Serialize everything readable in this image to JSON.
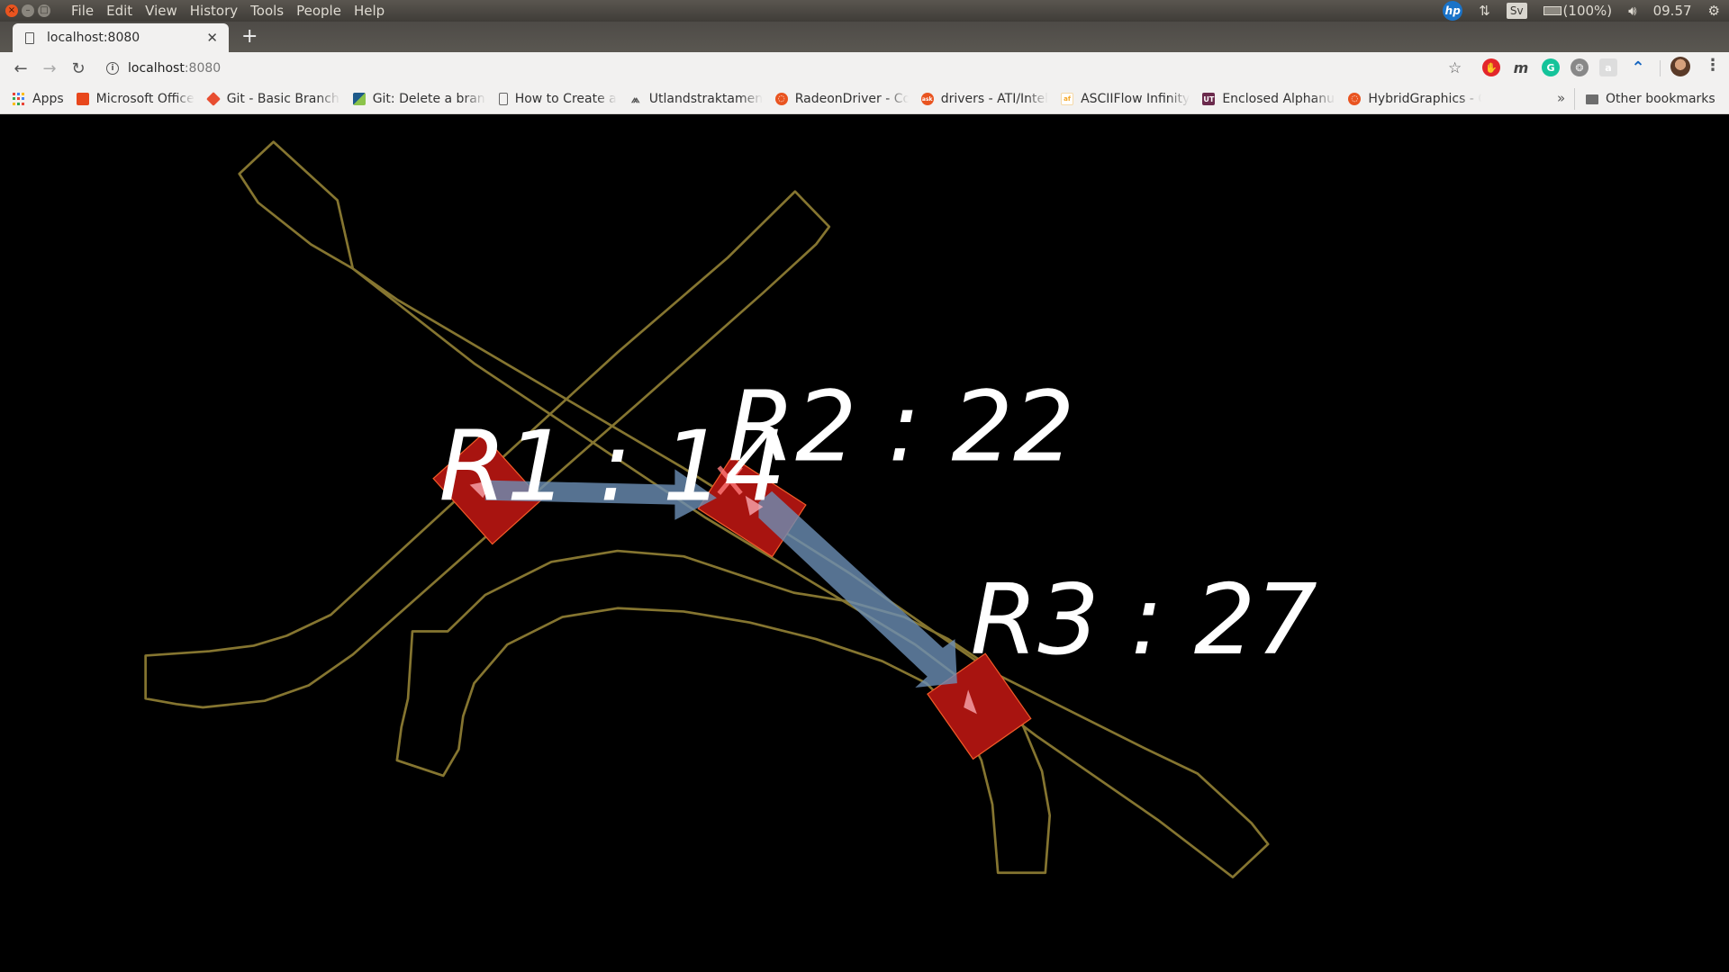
{
  "os": {
    "menu": [
      "File",
      "Edit",
      "View",
      "History",
      "Tools",
      "People",
      "Help"
    ],
    "tray": {
      "keyboard_layout": "Sv",
      "battery": "(100%)",
      "time": "09.57"
    }
  },
  "browser": {
    "tab": {
      "title": "localhost:8080"
    },
    "address": {
      "host": "localhost",
      "port": ":8080"
    },
    "bookmarks": [
      {
        "label": "Apps",
        "icon": "apps-grid-icon"
      },
      {
        "label": "Microsoft Office",
        "icon": "office-icon",
        "color": "#e8471c"
      },
      {
        "label": "Git - Basic Branching",
        "icon": "git-icon",
        "color": "#e84e31"
      },
      {
        "label": "Git: Delete a branch",
        "icon": "git-tower-icon",
        "color": "#1e5a8a"
      },
      {
        "label": "How to Create a",
        "icon": "page-icon"
      },
      {
        "label": "Utlandstraktamente",
        "icon": "skatteverket-icon"
      },
      {
        "label": "RadeonDriver - Community",
        "icon": "ubuntu-icon",
        "color": "#e95420"
      },
      {
        "label": "drivers - ATI/Intel",
        "icon": "askubuntu-icon",
        "color": "#e95420"
      },
      {
        "label": "ASCIIFlow Infinity",
        "icon": "asciiflow-icon",
        "color": "#f5a623"
      },
      {
        "label": "Enclosed Alphanumerics",
        "icon": "unicode-table-icon",
        "color": "#6b2a4c"
      },
      {
        "label": "HybridGraphics - Community",
        "icon": "ubuntu-icon",
        "color": "#e95420"
      }
    ],
    "overflow": "»",
    "other_bookmarks": "Other bookmarks",
    "extensions": [
      "adblock-icon",
      "m-extension-icon",
      "grammarly-icon",
      "film-reel-icon",
      "chat-extension-icon",
      "vpn-extension-icon"
    ]
  },
  "scene": {
    "colors": {
      "background": "#000000",
      "road_outline": "#857530",
      "region": "#b0120f",
      "path_arrow": "#6b8fb5"
    },
    "regions": [
      {
        "id": "R1",
        "value": 14,
        "text": "R1 : 14"
      },
      {
        "id": "R2",
        "value": 22,
        "text": "R2 : 22"
      },
      {
        "id": "R3",
        "value": 27,
        "text": "R3 : 27"
      }
    ]
  }
}
